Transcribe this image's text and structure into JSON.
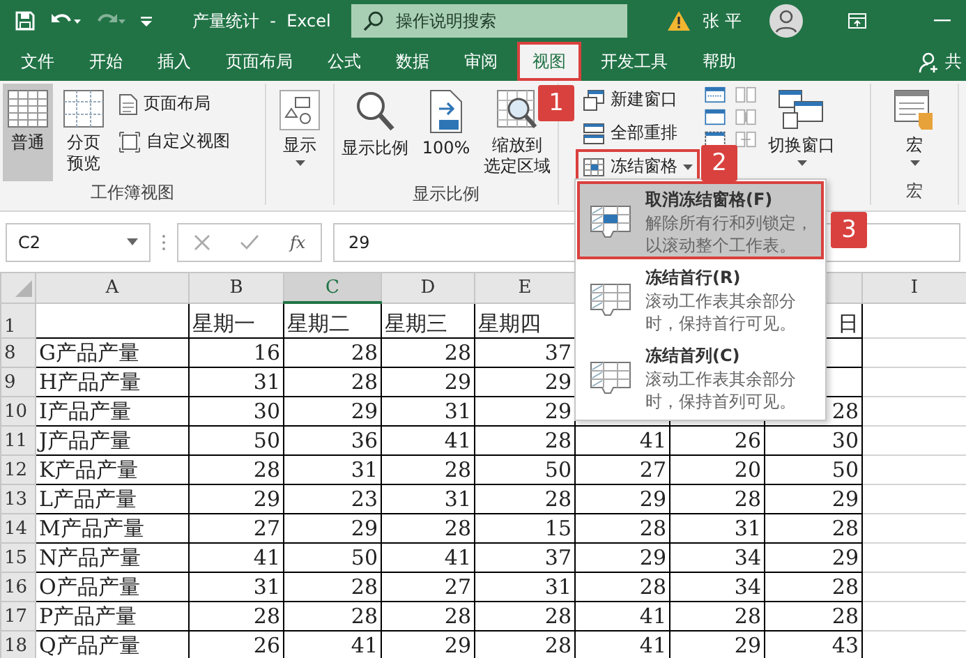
{
  "title_bar": {
    "document_title": "产量统计  -  Excel",
    "search_placeholder": "操作说明搜索",
    "user_name": "张 平"
  },
  "tabs": [
    {
      "label": "文件",
      "selected": false,
      "highlighted": false
    },
    {
      "label": "开始",
      "selected": false,
      "highlighted": false
    },
    {
      "label": "插入",
      "selected": false,
      "highlighted": false
    },
    {
      "label": "页面布局",
      "selected": false,
      "highlighted": false
    },
    {
      "label": "公式",
      "selected": false,
      "highlighted": false
    },
    {
      "label": "数据",
      "selected": false,
      "highlighted": false
    },
    {
      "label": "审阅",
      "selected": false,
      "highlighted": false
    },
    {
      "label": "视图",
      "selected": true,
      "highlighted": true
    },
    {
      "label": "开发工具",
      "selected": false,
      "highlighted": false
    },
    {
      "label": "帮助",
      "selected": false,
      "highlighted": false
    }
  ],
  "share_label": "共",
  "ribbon": {
    "normal": {
      "label": "普通",
      "selected": true
    },
    "page_break": {
      "label": "分页预览",
      "selected": false
    },
    "page_layout": "页面布局",
    "custom_views": "自定义视图",
    "workbook_views_group": "工作簿视图",
    "show": "显示",
    "zoom": "显示比例",
    "zoom_100": "100%",
    "zoom_selection": [
      "缩放到",
      "选定区域"
    ],
    "zoom_group": "显示比例",
    "new_window": "新建窗口",
    "arrange_all": "全部重排",
    "freeze_panes": {
      "label": "冻结窗格",
      "highlighted": true
    },
    "switch_windows": "切换窗口",
    "macros": "宏",
    "macros_group": "宏"
  },
  "freeze_menu": {
    "items": [
      {
        "title": "取消冻结窗格(F)",
        "description": [
          "解除所有行和列锁定，",
          "以滚动整个工作表。"
        ],
        "selected": true,
        "highlighted": true
      },
      {
        "title": "冻结首行(R)",
        "description": [
          "滚动工作表其余部分",
          "时，保持首行可见。"
        ],
        "selected": false,
        "highlighted": false
      },
      {
        "title": "冻结首列(C)",
        "description": [
          "滚动工作表其余部分",
          "时，保持首列可见。"
        ],
        "selected": false,
        "highlighted": false
      }
    ]
  },
  "callouts": [
    "1",
    "2",
    "3"
  ],
  "formula_bar": {
    "name_box": "C2",
    "function_label": "fx",
    "content": "29"
  },
  "sheet": {
    "columns": [
      {
        "label": "A",
        "selected": false
      },
      {
        "label": "B",
        "selected": false
      },
      {
        "label": "C",
        "selected": true
      },
      {
        "label": "D",
        "selected": false
      },
      {
        "label": "E",
        "selected": false
      },
      null,
      null,
      null,
      {
        "label": "I",
        "selected": false
      }
    ],
    "rows": [
      {
        "header": "1",
        "cells": [
          null,
          "星期一",
          "星期二",
          "星期三",
          "星期四",
          null,
          null,
          {
            "text": "日",
            "covered": true
          },
          null
        ]
      },
      {
        "header": "8",
        "cells": [
          "G产品产量",
          "16",
          "28",
          "28",
          "37",
          null,
          null,
          null,
          null
        ]
      },
      {
        "header": "9",
        "cells": [
          "H产品产量",
          "31",
          "28",
          "29",
          "29",
          null,
          null,
          null,
          null
        ]
      },
      {
        "header": "10",
        "cells": [
          "I产品产量",
          "30",
          "29",
          "31",
          "29",
          null,
          null,
          "28",
          null
        ]
      },
      {
        "header": "11",
        "cells": [
          "J产品产量",
          "50",
          "36",
          "41",
          "28",
          "41",
          "26",
          "30",
          null
        ]
      },
      {
        "header": "12",
        "cells": [
          "K产品产量",
          "28",
          "31",
          "28",
          "50",
          "27",
          "20",
          "50",
          null
        ]
      },
      {
        "header": "13",
        "cells": [
          "L产品产量",
          "29",
          "23",
          "31",
          "28",
          "29",
          "28",
          "29",
          null
        ]
      },
      {
        "header": "14",
        "cells": [
          "M产品产量",
          "27",
          "29",
          "28",
          "15",
          "28",
          "31",
          "28",
          null
        ]
      },
      {
        "header": "15",
        "cells": [
          "N产品产量",
          "41",
          "50",
          "41",
          "37",
          "29",
          "34",
          "29",
          null
        ]
      },
      {
        "header": "16",
        "cells": [
          "O产品产量",
          "31",
          "28",
          "27",
          "31",
          "28",
          "34",
          "28",
          null
        ]
      },
      {
        "header": "17",
        "cells": [
          "P产品产量",
          "28",
          "28",
          "28",
          "28",
          "41",
          "28",
          "28",
          null
        ]
      },
      {
        "header": "18",
        "cells": [
          "Q产品产量",
          "26",
          "41",
          "29",
          "28",
          "41",
          "29",
          "43",
          null
        ]
      }
    ]
  }
}
